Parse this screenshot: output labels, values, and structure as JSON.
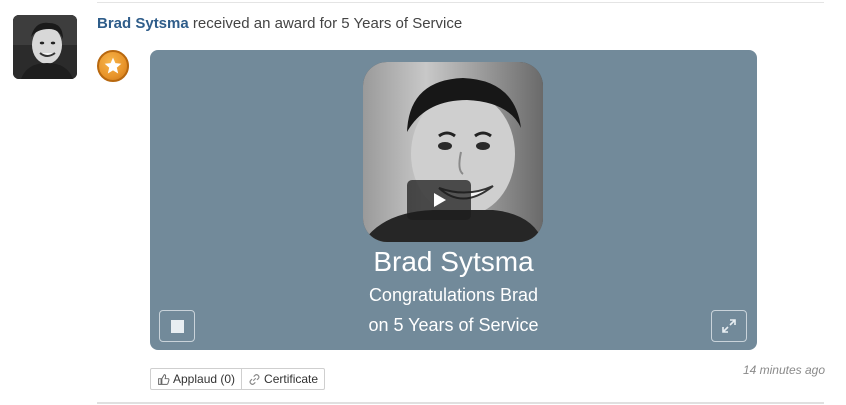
{
  "post": {
    "author": "Brad Sytsma",
    "action_text": "received an award for 5 Years of Service",
    "timestamp": "14 minutes ago"
  },
  "award_card": {
    "name": "Brad Sytsma",
    "line1": "Congratulations Brad",
    "line2": "on 5 Years of Service",
    "background": "#728a9a"
  },
  "icons": {
    "badge": "star-badge-icon",
    "play": "play-icon",
    "stop": "stop-icon",
    "expand": "expand-icon",
    "applaud": "thumbs-up-icon",
    "certificate": "link-icon"
  },
  "actions": {
    "applaud_label": "Applaud (0)",
    "certificate_label": "Certificate"
  },
  "colors": {
    "author_link": "#2f5d8a",
    "badge": "#e8942a"
  }
}
